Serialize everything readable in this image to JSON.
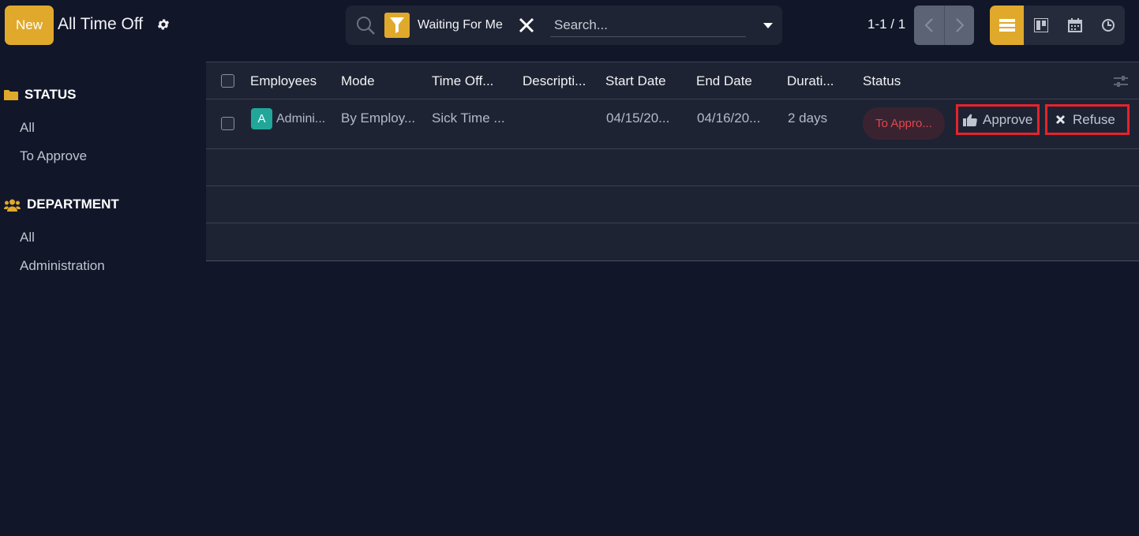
{
  "control_panel": {
    "new_label": "New",
    "title": "All Time Off",
    "search": {
      "facet_label": "Waiting For Me",
      "placeholder": "Search..."
    },
    "pager": {
      "value": "1-1 / 1"
    },
    "views": [
      "list",
      "kanban",
      "calendar",
      "activity"
    ],
    "accent_color": "#e0a92b"
  },
  "side_panel": {
    "sections": [
      {
        "title": "STATUS",
        "icon": "folder-icon",
        "items": [
          "All",
          "To Approve"
        ]
      },
      {
        "title": "DEPARTMENT",
        "icon": "users-icon",
        "items": [
          "All",
          "Administration"
        ]
      }
    ]
  },
  "list": {
    "columns": [
      "Employees",
      "Mode",
      "Time Off...",
      "Descripti...",
      "Start Date",
      "End Date",
      "Durati...",
      "Status"
    ],
    "rows": [
      {
        "avatar": "A",
        "employee": "Admini...",
        "mode": "By Employ...",
        "time_off_type": "Sick Time ...",
        "description": "",
        "start_date": "04/15/20...",
        "end_date": "04/16/20...",
        "duration": "2 days",
        "status": "To Appro...",
        "approve_label": "Approve",
        "refuse_label": "Refuse"
      }
    ],
    "status_color": "#e1474f"
  }
}
